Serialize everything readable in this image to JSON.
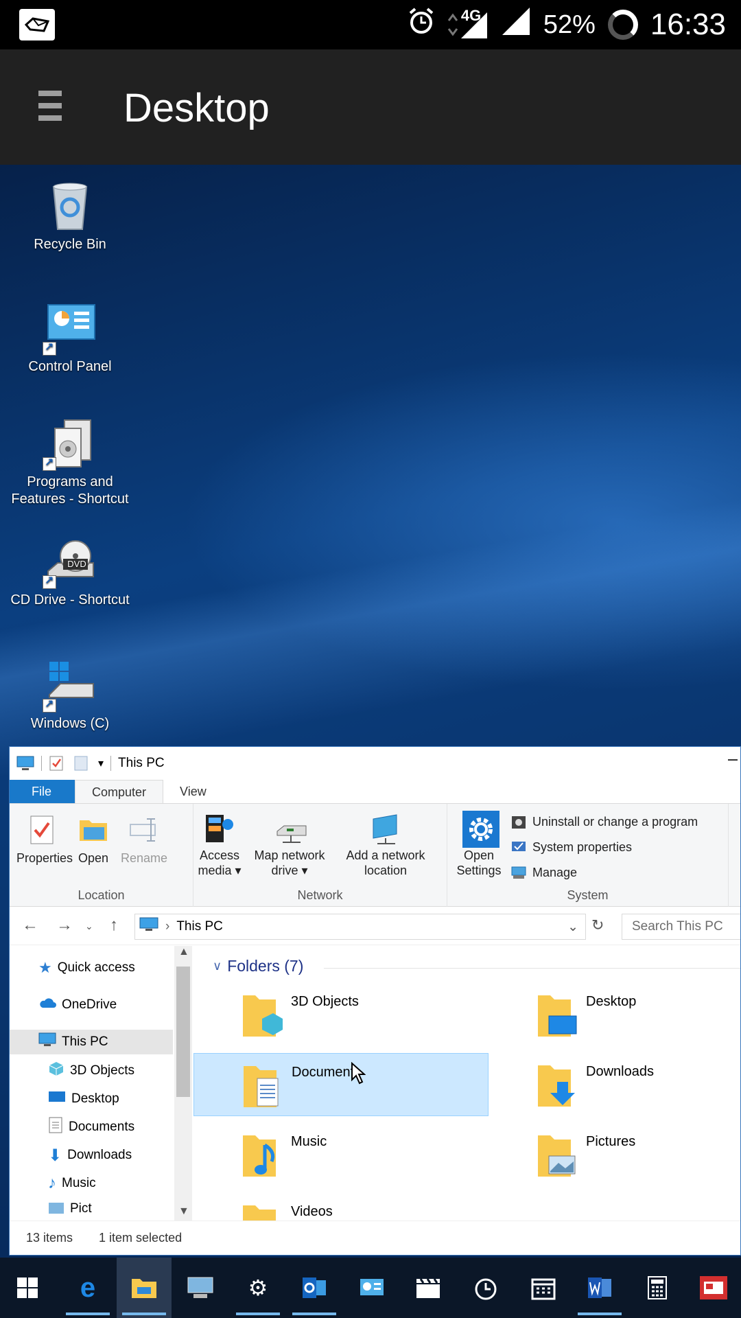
{
  "status_bar": {
    "network": "4G",
    "battery": "52%",
    "time": "16:33"
  },
  "app_bar": {
    "title": "Desktop"
  },
  "desktop_icons": [
    {
      "label": "Recycle Bin"
    },
    {
      "label": "Control Panel"
    },
    {
      "label": "Programs and Features - Shortcut"
    },
    {
      "label": "CD Drive - Shortcut",
      "badge": "DVD"
    },
    {
      "label": "Windows (C)"
    }
  ],
  "explorer": {
    "window_title": "This PC",
    "tabs": {
      "file": "File",
      "computer": "Computer",
      "view": "View"
    },
    "ribbon": {
      "location": {
        "group_label": "Location",
        "properties": "Properties",
        "open": "Open",
        "rename": "Rename"
      },
      "network": {
        "group_label": "Network",
        "access_media_1": "Access",
        "access_media_2": "media ▾",
        "map_drive_1": "Map network",
        "map_drive_2": "drive ▾",
        "add_location_1": "Add a network",
        "add_location_2": "location"
      },
      "system": {
        "group_label": "System",
        "open_settings_1": "Open",
        "open_settings_2": "Settings",
        "uninstall": "Uninstall or change a program",
        "system_properties": "System properties",
        "manage": "Manage"
      }
    },
    "address": {
      "path": "This PC",
      "search_placeholder": "Search This PC"
    },
    "nav_pane": [
      {
        "label": "Quick access"
      },
      {
        "label": "OneDrive"
      },
      {
        "label": "This PC"
      },
      {
        "label": "3D Objects"
      },
      {
        "label": "Desktop"
      },
      {
        "label": "Documents"
      },
      {
        "label": "Downloads"
      },
      {
        "label": "Music"
      },
      {
        "label": "Pict"
      }
    ],
    "folders_header": "Folders (7)",
    "folders": [
      {
        "name": "3D Objects"
      },
      {
        "name": "Desktop"
      },
      {
        "name": "Documents"
      },
      {
        "name": "Downloads"
      },
      {
        "name": "Music"
      },
      {
        "name": "Pictures"
      },
      {
        "name": "Videos"
      }
    ],
    "status": {
      "items": "13 items",
      "selected": "1 item selected"
    }
  },
  "taskbar": {
    "items": [
      "start",
      "edge",
      "file-explorer",
      "remote-desktop",
      "settings",
      "outlook",
      "control-panel",
      "movies",
      "alarms",
      "calendar",
      "word",
      "calculator",
      "news"
    ],
    "active_item": "file-explorer"
  },
  "colors": {
    "accent": "#1979ca",
    "selection": "#cce8ff",
    "appbar": "#212121",
    "taskbar": "#0b1728"
  }
}
